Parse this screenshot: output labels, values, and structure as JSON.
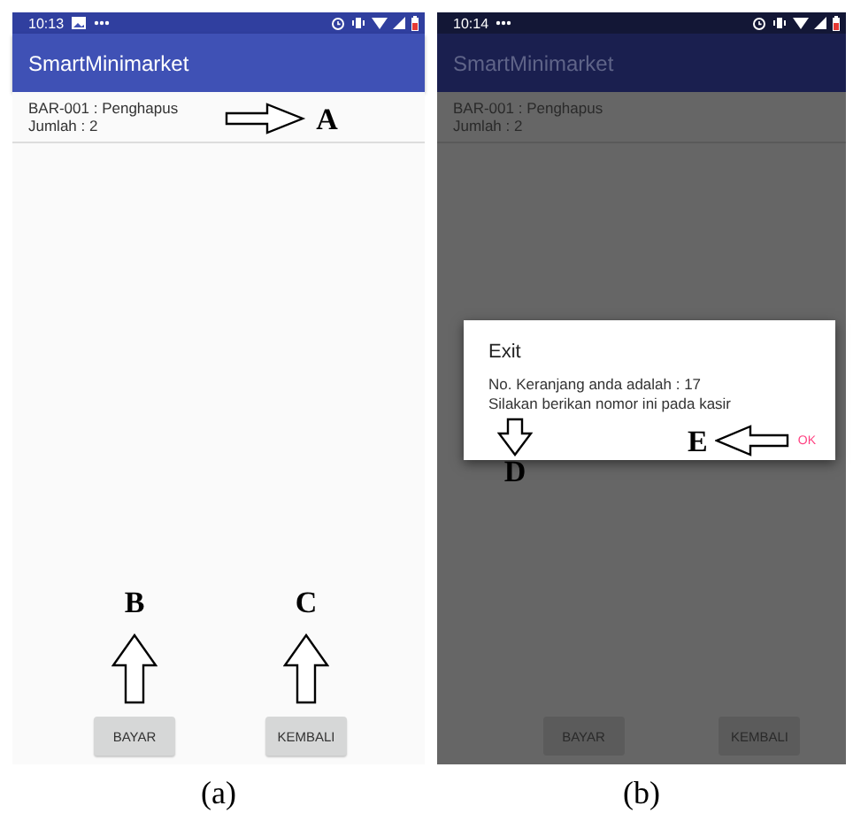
{
  "panels": [
    {
      "caption": "(a)",
      "dimmed": false,
      "status_bar": {
        "time": "10:13",
        "notifications": [
          {
            "kind": "image"
          },
          {
            "kind": "more"
          }
        ]
      },
      "app_title": "SmartMinimarket",
      "items": [
        {
          "title": "BAR-001 : Penghapus",
          "quantity": "Jumlah : 2",
          "annotation": {
            "label": "A",
            "kind": "right"
          }
        }
      ],
      "buttons": [
        {
          "label": "BAYAR",
          "annotation": {
            "label": "B",
            "kind": "up"
          }
        },
        {
          "label": "KEMBALI",
          "annotation": {
            "label": "C",
            "kind": "up"
          }
        }
      ]
    },
    {
      "caption": "(b)",
      "dimmed": true,
      "status_bar": {
        "time": "10:14",
        "notifications": [
          {
            "kind": "more"
          }
        ]
      },
      "app_title": "SmartMinimarket",
      "items": [
        {
          "title": "BAR-001 : Penghapus",
          "quantity": "Jumlah : 2"
        }
      ],
      "buttons": [
        {
          "label": "BAYAR"
        },
        {
          "label": "KEMBALI"
        }
      ],
      "dialog": {
        "title": "Exit",
        "message": [
          "No. Keranjang anda adalah : 17",
          "Silakan berikan nomor ini pada kasir"
        ],
        "message_annotation": {
          "label": "D",
          "kind": "down"
        },
        "ok_button": {
          "label": "OK",
          "annotation": {
            "label": "E",
            "kind": "left"
          }
        }
      }
    }
  ]
}
